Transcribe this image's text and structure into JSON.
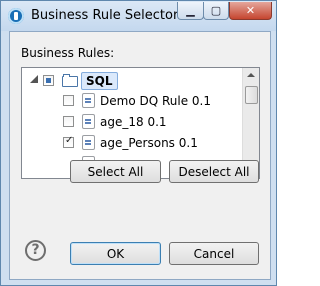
{
  "window": {
    "title": "Business Rule Selector"
  },
  "titlebar_buttons": {
    "minimize": "▁",
    "maximize": "▢",
    "close": "✕"
  },
  "label": "Business Rules:",
  "tree": {
    "root": {
      "label": "SQL",
      "state": "partial",
      "expanded": true
    },
    "items": [
      {
        "label": "Demo DQ Rule 0.1",
        "checked": false
      },
      {
        "label": "age_18 0.1",
        "checked": false
      },
      {
        "label": "age_Persons 0.1",
        "checked": true
      }
    ]
  },
  "buttons": {
    "select_all": "Select All",
    "deselect_all": "Deselect All",
    "ok": "OK",
    "cancel": "Cancel"
  },
  "help_icon": "?"
}
